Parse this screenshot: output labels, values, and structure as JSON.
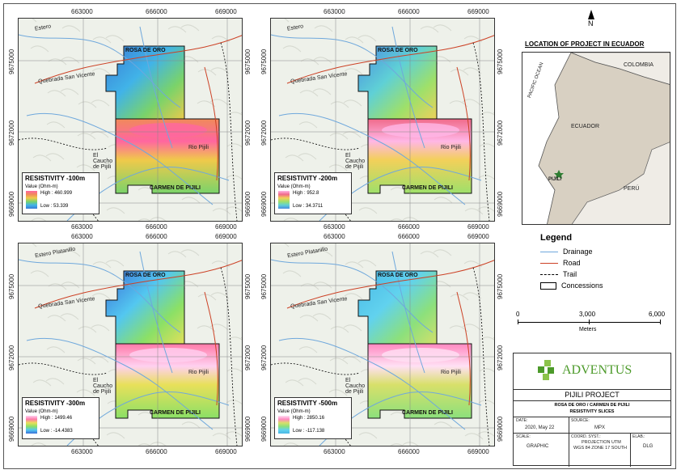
{
  "panels": [
    {
      "id": "p1",
      "x_ticks": [
        "663000",
        "666000",
        "669000"
      ],
      "y_ticks": [
        "9675000",
        "9672000",
        "9669000"
      ],
      "north_label": "ROSA DE ORO",
      "south_label": "CARMEN DE PIJILI",
      "legend": {
        "title": "RESISTIVITY -100m",
        "sub": "Value (Ohm-m)",
        "high": "High : 460.999",
        "low": "Low : 53.339"
      },
      "places": [
        "Estero",
        "Quebrada San Vicente",
        "El Caucho de Pijili",
        "Rio Pijili"
      ]
    },
    {
      "id": "p2",
      "x_ticks": [
        "663000",
        "666000",
        "669000"
      ],
      "y_ticks": [
        "9675000",
        "9672000",
        "9669000"
      ],
      "north_label": "ROSA DE ORO",
      "south_label": "CARMEN DE PIJILI",
      "legend": {
        "title": "RESISTIVITY -200m",
        "sub": "Value (Ohm-m)",
        "high": "High : 952.8",
        "low": "Low : 34.3711"
      },
      "places": [
        "Estero",
        "Quebrada San Vicente",
        "El Caucho de Pijili",
        "Rio Pijili"
      ]
    },
    {
      "id": "p3",
      "x_ticks": [
        "663000",
        "666000",
        "669000"
      ],
      "y_ticks": [
        "9675000",
        "9672000",
        "9669000"
      ],
      "north_label": "ROSA DE ORO",
      "south_label": "CARMEN DE PIJILI",
      "legend": {
        "title": "RESISTIVITY -300m",
        "sub": "Value (Ohm-m)",
        "high": "High : 1499.46",
        "low": "Low : -14.4383"
      },
      "places": [
        "Estero Platanillo",
        "Quebrada San Vicente",
        "El Caucho de Pijili",
        "Rio Pijili"
      ]
    },
    {
      "id": "p4",
      "x_ticks": [
        "663000",
        "666000",
        "669000"
      ],
      "y_ticks": [
        "9675000",
        "9672000",
        "9669000"
      ],
      "north_label": "ROSA DE ORO",
      "south_label": "CARMEN DE PIJILI",
      "legend": {
        "title": "RESISTIVITY -500m",
        "sub": "Value (Ohm-m)",
        "high": "High : 2850.16",
        "low": "Low : -117.138"
      },
      "places": [
        "Estero Platanillo",
        "Quebrada San Vicente",
        "El Caucho de Pijili",
        "Rio Pijili"
      ]
    }
  ],
  "location_map": {
    "title": "LOCATION OF PROJECT IN ECUADOR",
    "north": "N",
    "labels": {
      "colombia": "COLOMBIA",
      "ocean": "PACIFIC OCEAN",
      "ecuador": "ECUADOR",
      "peru": "PERÚ",
      "project": "PIJILI"
    }
  },
  "legend": {
    "title": "Legend",
    "items": [
      {
        "label": "Drainage",
        "color": "#6fa8dc"
      },
      {
        "label": "Road",
        "color": "#cc4125"
      },
      {
        "label": "Trail",
        "color": "#000000"
      },
      {
        "label": "Concessions",
        "color": "#000000"
      }
    ]
  },
  "scale": {
    "ticks": [
      "0",
      "3,000",
      "6,000"
    ],
    "unit": "Meters"
  },
  "title_block": {
    "company": "ADVENTUS",
    "project": "PIJILI PROJECT",
    "subtitle1": "ROSA DE ORO / CARMEN DE PIJILI",
    "subtitle2": "RESISTIVITY SLICES",
    "date_label": "DATE:",
    "date": "2020, May 22",
    "source_label": "SOURCE:",
    "source": "MPX",
    "scale_label": "SCALE:",
    "scale": "GRAPHIC",
    "coord_label": "COORD. SYST.:",
    "coord1": "PROJECTION UTM",
    "coord2": "WGS 84 ZONE 17 SOUTH",
    "elab_label": "ELAB.:",
    "elab": "DLG"
  },
  "colors": {
    "drainage": "#6fa8dc",
    "road": "#cc4125",
    "brand_green": "#4c9a2a"
  }
}
